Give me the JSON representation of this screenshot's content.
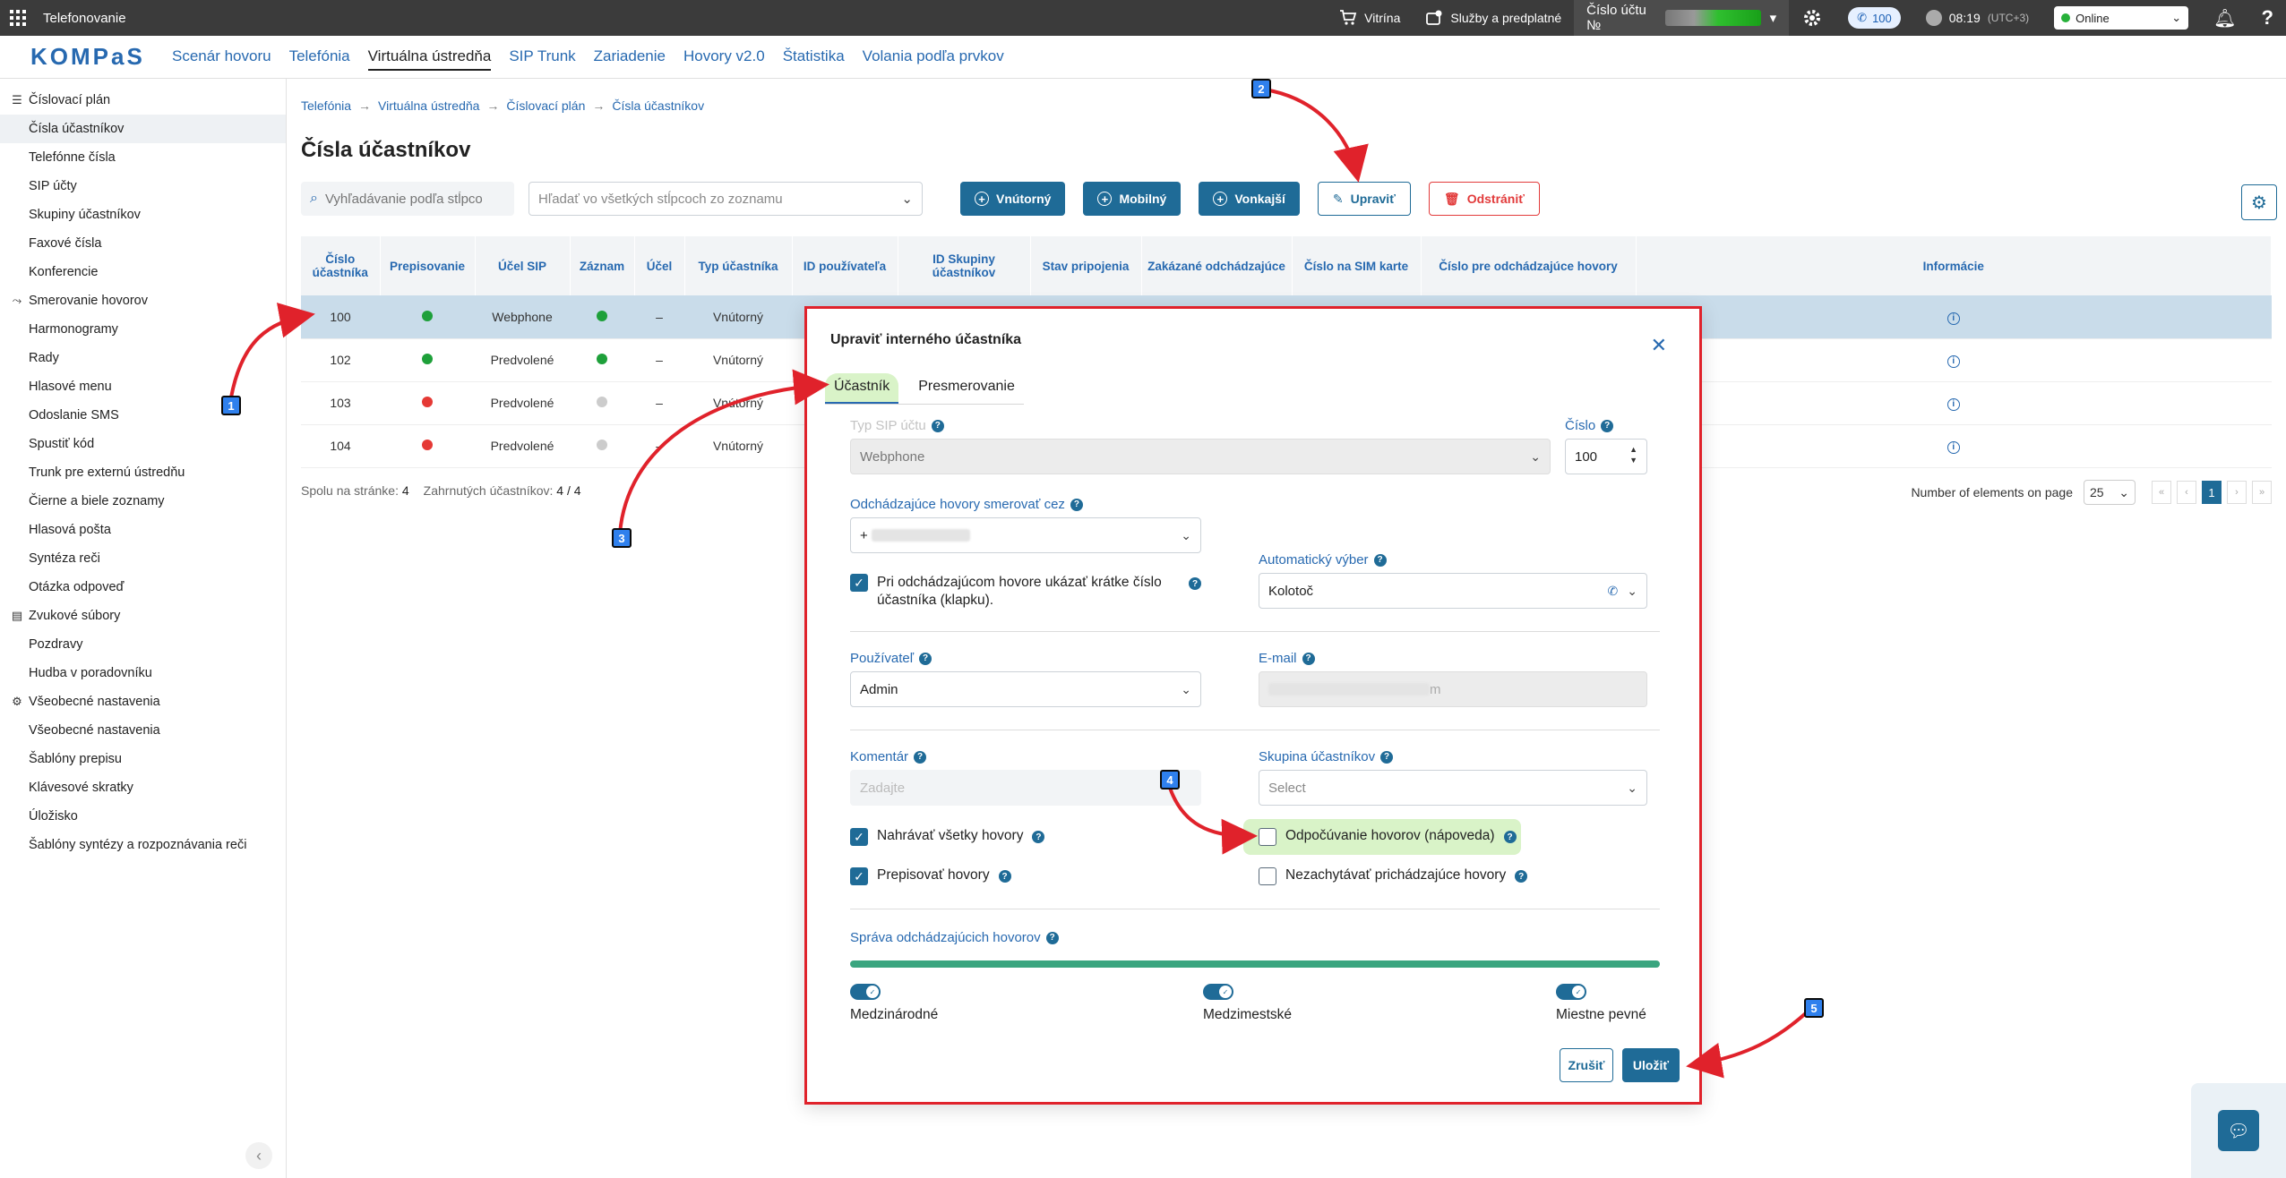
{
  "topbar": {
    "app_title": "Telefonovanie",
    "showcase": "Vitrína",
    "services": "Služby a predplatné",
    "account_label": "Číslo účtu №",
    "calls_count": "100",
    "time": "08:19",
    "timezone": "(UTC+3)",
    "status": "Online"
  },
  "nav": {
    "logo": "KOMPaS",
    "links": [
      "Scenár hovoru",
      "Telefónia",
      "Virtuálna ústredňa",
      "SIP Trunk",
      "Zariadenie",
      "Hovory v2.0",
      "Štatistika",
      "Volania podľa prvkov"
    ]
  },
  "sidebar": {
    "items": [
      {
        "label": "Číslovací plán",
        "group": true,
        "icon": "list-icon"
      },
      {
        "label": "Čísla účastníkov",
        "selected": true
      },
      {
        "label": "Telefónne čísla"
      },
      {
        "label": "SIP účty"
      },
      {
        "label": "Skupiny účastníkov"
      },
      {
        "label": "Faxové čísla"
      },
      {
        "label": "Konferencie"
      },
      {
        "label": "Smerovanie hovorov",
        "group": true,
        "icon": "routing-icon"
      },
      {
        "label": "Harmonogramy"
      },
      {
        "label": "Rady"
      },
      {
        "label": "Hlasové menu"
      },
      {
        "label": "Odoslanie SMS"
      },
      {
        "label": "Spustiť kód"
      },
      {
        "label": "Trunk pre externú ústredňu"
      },
      {
        "label": "Čierne a biele zoznamy"
      },
      {
        "label": "Hlasová pošta"
      },
      {
        "label": "Syntéza reči"
      },
      {
        "label": "Otázka odpoveď"
      },
      {
        "label": "Zvukové súbory",
        "group": true,
        "icon": "audio-files-icon"
      },
      {
        "label": "Pozdravy"
      },
      {
        "label": "Hudba v poradovníku"
      },
      {
        "label": "Všeobecné nastavenia",
        "group": true,
        "icon": "gear-icon"
      },
      {
        "label": "Všeobecné nastavenia"
      },
      {
        "label": "Šablóny prepisu"
      },
      {
        "label": "Klávesové skratky"
      },
      {
        "label": "Úložisko"
      },
      {
        "label": "Šablóny syntézy a rozpoznávania reči"
      }
    ]
  },
  "breadcrumb": [
    "Telefónia",
    "Virtuálna ústredňa",
    "Číslovací plán",
    "Čísla účastníkov"
  ],
  "page_title": "Čísla účastníkov",
  "toolbar": {
    "search_placeholder": "Vyhľadávanie podľa stĺpco",
    "filter_placeholder": "Hľadať vo všetkých stĺpcoch zo zoznamu",
    "btn_internal": "Vnútorný",
    "btn_mobile": "Mobilný",
    "btn_external": "Vonkajší",
    "btn_edit": "Upraviť",
    "btn_delete": "Odstrániť"
  },
  "table": {
    "headers": [
      "Číslo účastníka",
      "Prepisovanie",
      "Účel SIP",
      "Záznam",
      "Účel",
      "Typ účastníka",
      "ID používateľa",
      "ID Skupiny účastníkov",
      "Stav pripojenia",
      "Zakázané odchádzajúce",
      "Číslo na SIM karte",
      "Číslo pre odchádzajúce hovory",
      "Informácie"
    ],
    "rows": [
      {
        "number": "100",
        "transcribe": "green",
        "sip": "Webphone",
        "record": "green",
        "purpose": "–",
        "type": "Vnútorný",
        "selected": true
      },
      {
        "number": "102",
        "transcribe": "green",
        "sip": "Predvolené",
        "record": "green",
        "purpose": "–",
        "type": "Vnútorný"
      },
      {
        "number": "103",
        "transcribe": "red",
        "sip": "Predvolené",
        "record": "gray",
        "purpose": "–",
        "type": "Vnútorný"
      },
      {
        "number": "104",
        "transcribe": "red",
        "sip": "Predvolené",
        "record": "gray",
        "purpose": "–",
        "type": "Vnútorný"
      }
    ],
    "footer_page_label": "Spolu na stránke:",
    "footer_page_value": "4",
    "footer_included_label": "Zahrnutých účastníkov:",
    "footer_included_value": "4 / 4",
    "pager_label": "Number of elements on page",
    "page_size": "25",
    "current_page": "1"
  },
  "modal": {
    "title": "Upraviť interného účastníka",
    "tabs": [
      "Účastník",
      "Presmerovanie"
    ],
    "sip_type_label": "Typ SIP účtu",
    "sip_type_value": "Webphone",
    "number_label": "Číslo",
    "number_value": "100",
    "outgoing_label": "Odchádzajúce hovory smerovať cez",
    "outgoing_value": "+",
    "short_number_label": "Pri odchádzajúcom hovore ukázať krátke číslo účastníka (klapku).",
    "auto_select_label": "Automatický výber",
    "auto_select_value": "Kolotoč",
    "user_label": "Používateľ",
    "user_value": "Admin",
    "email_label": "E-mail",
    "email_suffix": "m",
    "comment_label": "Komentár",
    "comment_placeholder": "Zadajte",
    "group_label": "Skupina účastníkov",
    "group_placeholder": "Select",
    "record_all_label": "Nahrávať všetky hovory",
    "listen_label": "Odpočúvanie hovorov (nápoveda)",
    "transcribe_label": "Prepisovať hovory",
    "no_intercept_label": "Nezachytávať prichádzajúce hovory",
    "outgoing_mgmt_label": "Správa odchádzajúcich hovorov",
    "outgoing_mgmt_level": 1.0,
    "toggle_international": "Medzinárodné",
    "toggle_intercity": "Medzimestské",
    "toggle_local": "Miestne pevné",
    "cancel": "Zrušiť",
    "save": "Uložiť"
  },
  "annotations": [
    "1",
    "2",
    "3",
    "4",
    "5"
  ],
  "colors": {
    "accent": "#1f6b97",
    "link": "#2769b0",
    "danger": "#e23b3b",
    "highlight": "#d9f3c8",
    "annotation_arrow": "#e0222b"
  }
}
